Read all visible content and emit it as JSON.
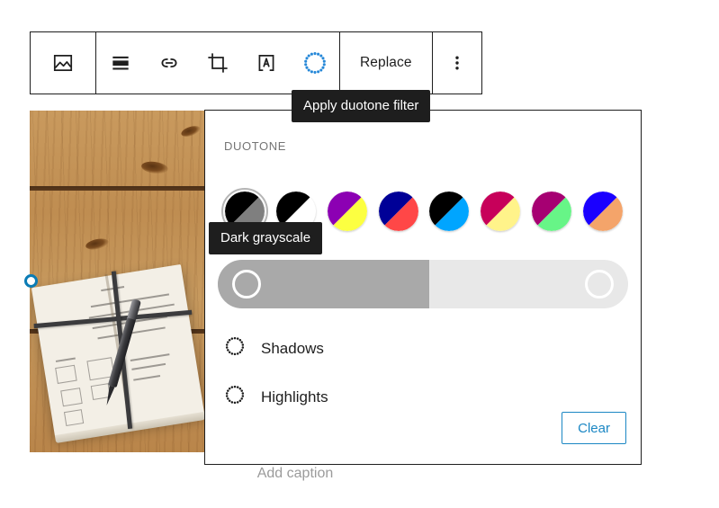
{
  "toolbar": {
    "buttons": [
      {
        "name": "image-block-type",
        "icon": "image-icon",
        "label": ""
      },
      {
        "name": "align",
        "icon": "align-center-icon",
        "label": ""
      },
      {
        "name": "link",
        "icon": "link-icon",
        "label": ""
      },
      {
        "name": "crop",
        "icon": "crop-icon",
        "label": ""
      },
      {
        "name": "text-over-image",
        "icon": "text-in-frame-icon",
        "label": ""
      },
      {
        "name": "duotone",
        "icon": "duotone-dotted-circle-icon",
        "label": ""
      }
    ],
    "replace_label": "Replace",
    "more_options_icon": "vertical-ellipsis-icon"
  },
  "tooltips": {
    "duotone": "Apply duotone filter",
    "dark_grayscale": "Dark grayscale"
  },
  "image_block": {
    "caption_placeholder": "Add caption",
    "resize_handle": "left-resize-handle",
    "alt_description": "Wooden desk with open notebook, pen and tablet"
  },
  "duotone_panel": {
    "title": "DUOTONE",
    "swatches": [
      {
        "name": "dark-grayscale",
        "shadow": "#000000",
        "highlight": "#7f7f7f",
        "selected": true
      },
      {
        "name": "grayscale",
        "shadow": "#000000",
        "highlight": "#ffffff",
        "selected": false
      },
      {
        "name": "purple-yellow",
        "shadow": "#8c00b3",
        "highlight": "#fcff41",
        "selected": false
      },
      {
        "name": "blue-red",
        "shadow": "#000097",
        "highlight": "#ff4747",
        "selected": false
      },
      {
        "name": "midnight",
        "shadow": "#000000",
        "highlight": "#00a5ff",
        "selected": false
      },
      {
        "name": "magenta-yellow",
        "shadow": "#c7005a",
        "highlight": "#fff38a",
        "selected": false
      },
      {
        "name": "purple-green",
        "shadow": "#a60072",
        "highlight": "#67f587",
        "selected": false
      },
      {
        "name": "blue-orange",
        "shadow": "#1a00ff",
        "highlight": "#f4a46a",
        "selected": false
      }
    ],
    "slider": {
      "name": "duotone-range-slider",
      "fill_percent": 51.5,
      "left_handle": "shadows-handle",
      "right_handle": "highlights-handle"
    },
    "color_rows": [
      {
        "name": "shadows",
        "label": "Shadows",
        "icon": "dotted-circle-icon"
      },
      {
        "name": "highlights",
        "label": "Highlights",
        "icon": "dotted-circle-icon"
      }
    ],
    "clear_label": "Clear"
  },
  "colors": {
    "accent": "#1b87c4",
    "duotone_icon": "#2688d8",
    "toolbar_border": "#1e1e1e",
    "tooltip_bg": "#1e1e1e",
    "panel_title": "#757575",
    "caption": "#9b9b9b",
    "slider_fill": "#a9a9a9",
    "slider_track": "#e8e8e8",
    "resize_handle": "#0b7cb5"
  }
}
